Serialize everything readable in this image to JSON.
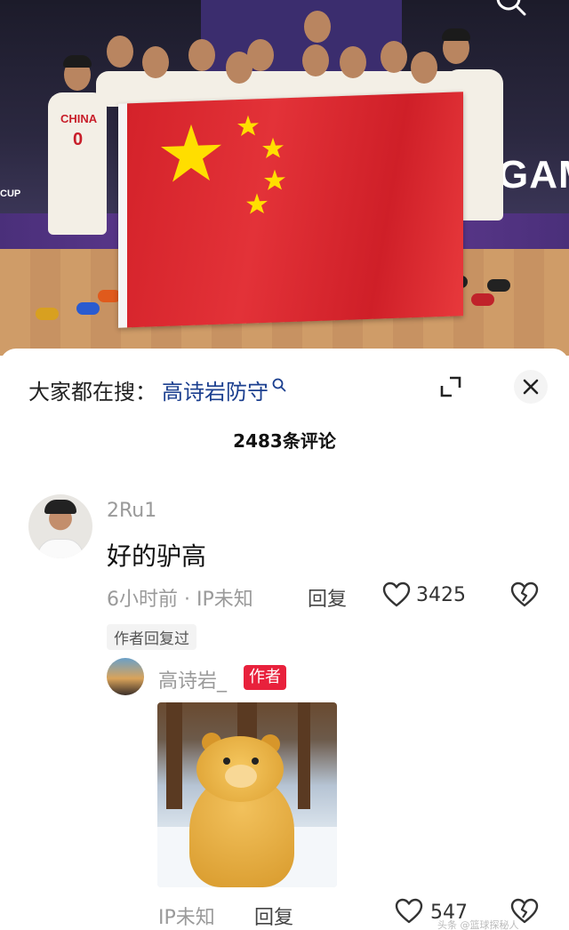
{
  "photo": {
    "backdrop_text": "GAM",
    "cup_text": "CUP",
    "jersey_country": "CHINA",
    "jersey_number": "0"
  },
  "sheet": {
    "search_prefix": "大家都在搜：",
    "search_term": "高诗岩防守",
    "comment_count": "2483条评论"
  },
  "comments": [
    {
      "username": "2Ru1",
      "text": "好的驴高",
      "meta": "6小时前 · IP未知",
      "reply_label": "回复",
      "likes": "3425",
      "author_replied": "作者回复过",
      "reply": {
        "username": "高诗岩_",
        "badge": "作者",
        "ip": "IP未知",
        "reply_label": "回复",
        "likes": "547"
      }
    }
  ],
  "watermark": "头条 @篮球探秘人"
}
